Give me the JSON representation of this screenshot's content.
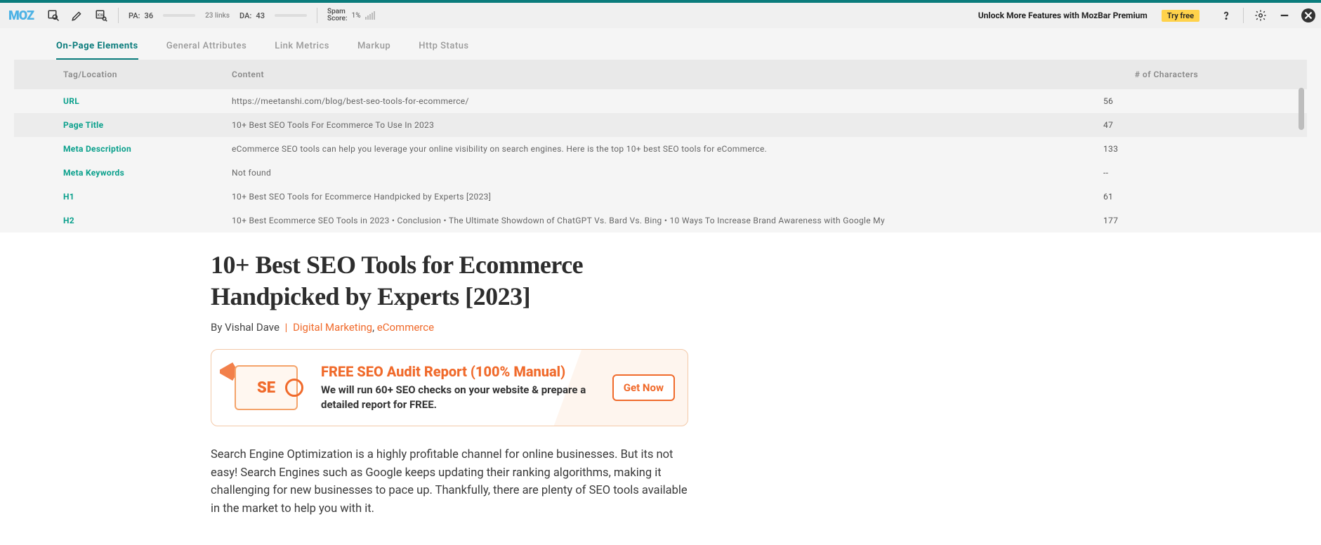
{
  "topbar": {
    "logo": "MOZ",
    "pa_label": "PA:",
    "pa_value": "36",
    "pa_bar_pct": 36,
    "links_label": "23 links",
    "da_label": "DA:",
    "da_value": "43",
    "da_bar_pct": 43,
    "spam_label_1": "Spam",
    "spam_label_2": "Score:",
    "spam_value": "1%",
    "premium_text": "Unlock More Features with MozBar Premium",
    "try_free": "Try free"
  },
  "tabs": {
    "items": [
      {
        "label": "On-Page Elements",
        "active": true
      },
      {
        "label": "General Attributes",
        "active": false
      },
      {
        "label": "Link Metrics",
        "active": false
      },
      {
        "label": "Markup",
        "active": false
      },
      {
        "label": "Http Status",
        "active": false
      }
    ]
  },
  "table": {
    "header": {
      "c1": "Tag/Location",
      "c2": "Content",
      "c3": "# of Characters"
    },
    "rows": [
      {
        "tag": "URL",
        "content": "https://meetanshi.com/blog/best-seo-tools-for-ecommerce/",
        "chars": "56",
        "alt": false
      },
      {
        "tag": "Page Title",
        "content": "10+ Best SEO Tools For Ecommerce To Use In 2023",
        "chars": "47",
        "alt": true
      },
      {
        "tag": "Meta Description",
        "content": "eCommerce SEO tools can help you leverage your online visibility on search engines. Here is the top 10+ best SEO tools for eCommerce.",
        "chars": "133",
        "alt": false
      },
      {
        "tag": "Meta Keywords",
        "content": "Not found",
        "chars": "--",
        "alt": false
      },
      {
        "tag": "H1",
        "content": "10+ Best SEO Tools for Ecommerce Handpicked by Experts [2023]",
        "chars": "61",
        "alt": false
      },
      {
        "tag": "H2",
        "content": "10+ Best Ecommerce SEO Tools in 2023 • Conclusion • The Ultimate Showdown of ChatGPT Vs. Bard Vs. Bing • 10 Ways To Increase Brand Awareness with Google My",
        "chars": "177",
        "alt": false
      }
    ]
  },
  "article": {
    "title": "10+ Best SEO Tools for Ecommerce Handpicked by Experts [2023]",
    "byline_prefix": "By ",
    "author": "Vishal Dave",
    "category1": "Digital Marketing",
    "category_sep": ", ",
    "category2": "eCommerce",
    "cta_title": "FREE SEO Audit Report (100% Manual)",
    "cta_sub": "We will run 60+ SEO checks on your website & prepare a detailed report for FREE.",
    "cta_button": "Get Now",
    "seo_box_text": "SE",
    "paragraph": "Search Engine Optimization is a highly profitable channel for online businesses. But its not easy! Search Engines such as Google keeps updating their ranking algorithms, making it challenging for new businesses to pace up. Thankfully, there are plenty of SEO tools available in the market to help you with it."
  }
}
